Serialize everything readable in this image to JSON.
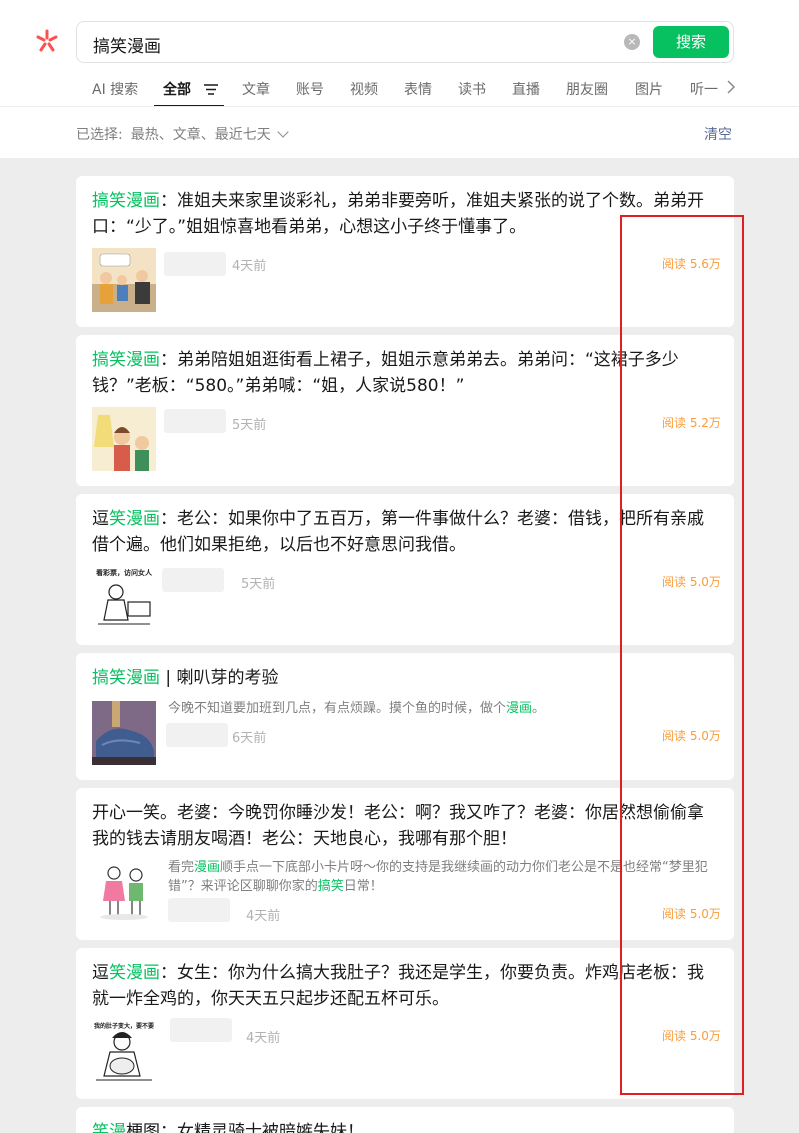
{
  "search": {
    "query": "搞笑漫画",
    "button": "搜索",
    "clear_icon": "×"
  },
  "tabs": [
    {
      "label": "AI 搜索"
    },
    {
      "label": "全部"
    },
    {
      "label": "文章"
    },
    {
      "label": "账号"
    },
    {
      "label": "视频"
    },
    {
      "label": "表情"
    },
    {
      "label": "读书"
    },
    {
      "label": "直播"
    },
    {
      "label": "朋友圈"
    },
    {
      "label": "图片"
    },
    {
      "label": "听一"
    }
  ],
  "filters": {
    "label": "已选择:",
    "value": "最热、文章、最近七天",
    "clear": "清空"
  },
  "colors": {
    "accent": "#07c160",
    "read_count": "#fa9d3b",
    "link": "#576b95",
    "highlight_box": "#e02020"
  },
  "results": [
    {
      "title_hl": "搞笑漫画",
      "title_rest": "：准姐夫来家里谈彩礼，弟弟非要旁听，准姐夫紧张的说了个数。弟弟开口：“少了。”姐姐惊喜地看弟弟，心想这小子终于懂事了。",
      "thumb_icon": "comic-family-thumbnail",
      "time": "4天前",
      "reads": "阅读 5.6万"
    },
    {
      "title_hl": "搞笑漫画",
      "title_rest": "：弟弟陪姐姐逛街看上裙子，姐姐示意弟弟去。弟弟问：“这裙子多少钱？”老板：“580。”弟弟喊：“姐，人家说580！”",
      "thumb_icon": "comic-siblings-thumbnail",
      "time": "5天前",
      "reads": "阅读 5.2万"
    },
    {
      "title_pre": "逗",
      "title_hl": "笑漫画",
      "title_rest": "：老公：如果你中了五百万，第一件事做什么？老婆：借钱，把所有亲戚借个遍。他们如果拒绝，以后也不好意思问我借。",
      "thumb_icon": "comic-sketch-thumbnail",
      "thumb_caption": "看彩票，访问女人",
      "time": "5天前",
      "reads": "阅读 5.0万"
    },
    {
      "title_hl": "搞笑漫画",
      "title_rest": " | 喇叭芽的考验",
      "summary_pre": "今晚不知道要加班到几点，有点烦躁。摸个鱼的时候，做个",
      "summary_hl": "漫画",
      "summary_post": "。",
      "thumb_icon": "comic-blanket-thumbnail",
      "time": "6天前",
      "reads": "阅读 5.0万"
    },
    {
      "title_rest": "开心一笑。老婆：今晚罚你睡沙发！老公：啊？我又咋了？老婆：你居然想偷偷拿我的钱去请朋友喝酒！老公：天地良心，我哪有那个胆！",
      "summary_pre": "看完",
      "summary_hl": "漫画",
      "summary_mid": "顺手点一下底部小卡片呀～你的支持是我继续画的动力你们老公是不是也经常“梦里犯错”？来评论区聊聊你家的",
      "summary_hl2": "搞笑",
      "summary_post": "日常！",
      "thumb_icon": "comic-couple-thumbnail",
      "time": "4天前",
      "reads": "阅读 5.0万"
    },
    {
      "title_pre": "逗",
      "title_hl": "笑漫画",
      "title_rest": "：女生：你为什么搞大我肚子？我还是学生，你要负责。炸鸡店老板：我就一炸全鸡的，你天天五只起步还配五杯可乐。",
      "thumb_icon": "comic-girl-thumbnail",
      "thumb_caption": "我的肚子变大，要不要",
      "time": "4天前",
      "reads": "阅读 5.0万"
    },
    {
      "title_hl": "笑漫",
      "title_rest": "梗图：女精灵骑士被暗嫉失妹！"
    }
  ]
}
